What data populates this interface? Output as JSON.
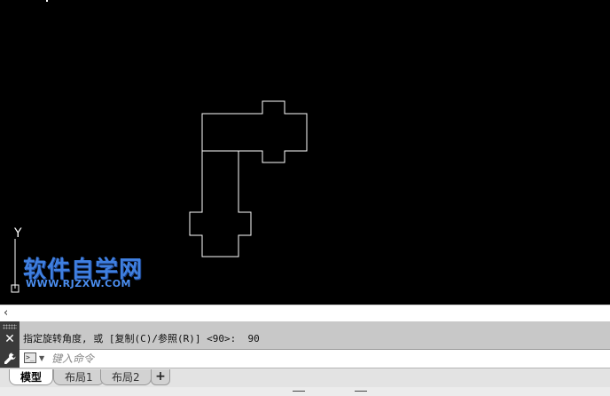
{
  "canvas": {
    "background": "#000000",
    "line_color": "#ffffff",
    "ucs_y_label": "Y"
  },
  "watermark": {
    "title": "软件自学网",
    "url": "WWW.RJZXW.COM",
    "color": "#3f7fe0"
  },
  "command_line": {
    "collapse_icon": "chevron-left-icon",
    "prompt": "指定旋转角度, 或 [复制(C)/参照(R)] <90>:  90",
    "input_placeholder": "键入命令",
    "input_value": ""
  },
  "layout_tabs": {
    "tabs": [
      {
        "label": "模型",
        "active": true
      },
      {
        "label": "布局1",
        "active": false
      },
      {
        "label": "布局2",
        "active": false
      }
    ],
    "add_label": "+"
  }
}
